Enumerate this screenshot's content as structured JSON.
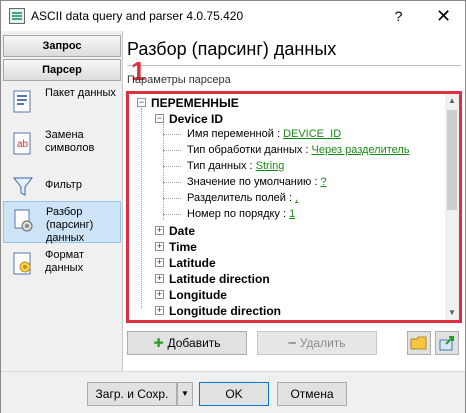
{
  "window": {
    "title": "ASCII data query and parser 4.0.75.420",
    "help_label": "?",
    "close_label": "✕"
  },
  "sidebar": {
    "headers": [
      "Запрос",
      "Парсер"
    ],
    "items": [
      {
        "label": "Пакет данных",
        "icon": "packet-icon"
      },
      {
        "label": "Замена символов",
        "icon": "replace-symbols-icon"
      },
      {
        "label": "Фильтр",
        "icon": "filter-icon"
      },
      {
        "label": "Разбор (парсинг) данных",
        "icon": "parsing-icon",
        "active": true
      },
      {
        "label": "Формат данных",
        "icon": "data-format-icon"
      }
    ]
  },
  "main": {
    "heading": "Разбор (парсинг) данных",
    "subheading": "Параметры парсера",
    "annotation": "1"
  },
  "tree": {
    "root": "ПЕРЕМЕННЫЕ",
    "device": "Device ID",
    "props": [
      {
        "label": "Имя переменной : ",
        "value": "DEVICE_ID"
      },
      {
        "label": "Тип обработки данных : ",
        "value": "Через разделитель"
      },
      {
        "label": "Тип данных : ",
        "value": "String"
      },
      {
        "label": "Значение по умолчанию : ",
        "value": "?"
      },
      {
        "label": "Разделитель полей : ",
        "value": ","
      },
      {
        "label": "Номер по порядку : ",
        "value": "1"
      }
    ],
    "variables": [
      "Date",
      "Time",
      "Latitude",
      "Latitude direction",
      "Longitude",
      "Longitude direction"
    ]
  },
  "actions": {
    "add_label": "Добавить",
    "delete_label": "Удалить"
  },
  "footer": {
    "load_save_label": "Загр. и Сохр.",
    "dropdown_arrow": "▼",
    "ok_label": "OK",
    "cancel_label": "Отмена"
  },
  "colors": {
    "highlight": "#e03040",
    "link": "#1a8a1a",
    "selection": "#cde4f7"
  }
}
